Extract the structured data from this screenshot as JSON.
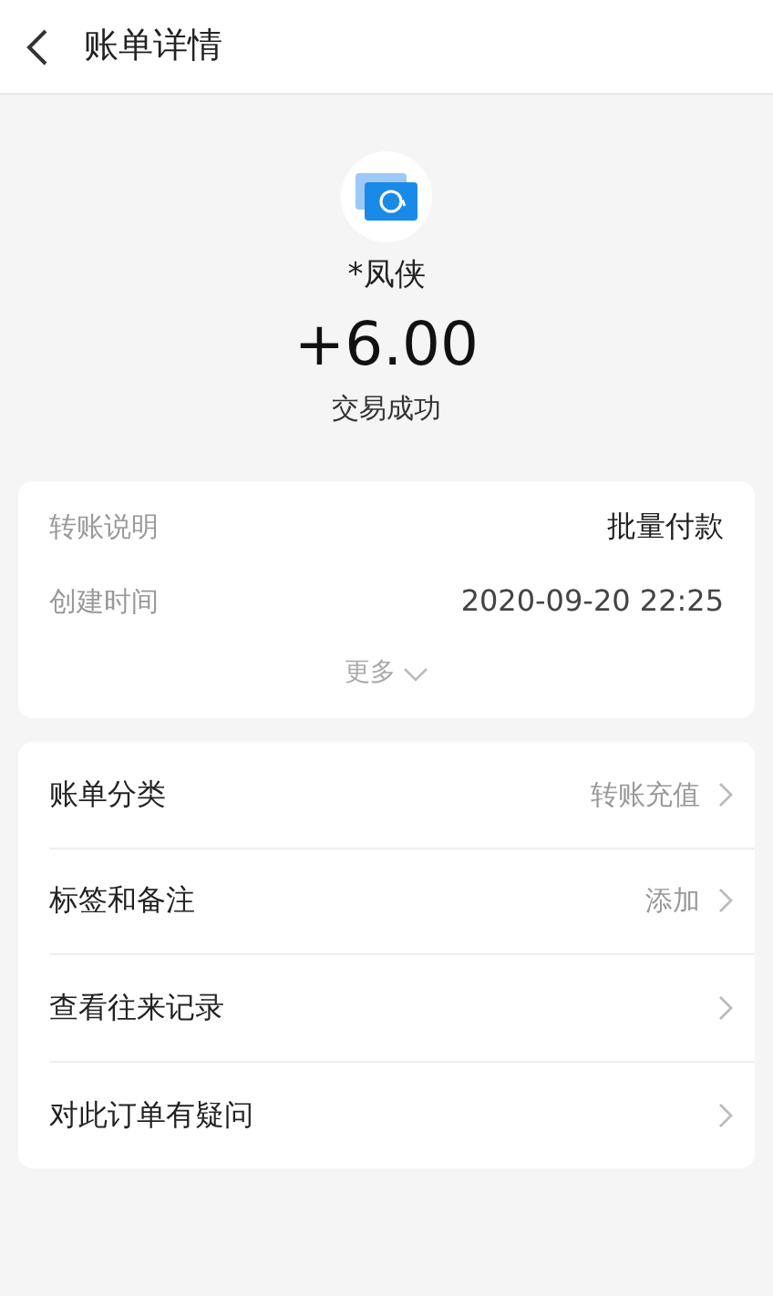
{
  "header": {
    "title": "账单详情"
  },
  "summary": {
    "name": "*凤侠",
    "amount": "+6.00",
    "status": "交易成功"
  },
  "details": [
    {
      "label": "转账说明",
      "value": "批量付款",
      "emphasis": true
    },
    {
      "label": "创建时间",
      "value": "2020-09-20 22:25",
      "emphasis": false
    }
  ],
  "more": "更多",
  "actions": [
    {
      "label": "账单分类",
      "value": "转账充值"
    },
    {
      "label": "标签和备注",
      "value": "添加"
    },
    {
      "label": "查看往来记录"
    },
    {
      "label": "对此订单有疑问"
    }
  ]
}
